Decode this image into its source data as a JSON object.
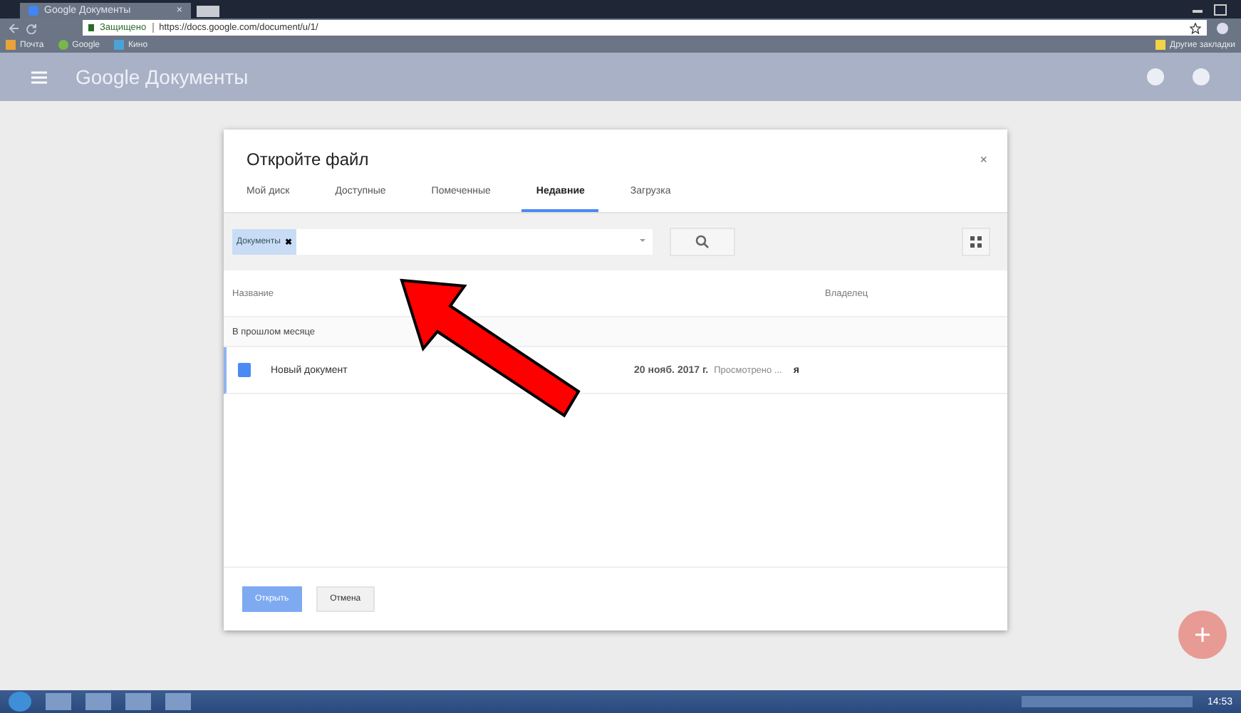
{
  "browser": {
    "tab_title": "Google Документы",
    "tab_close": "×",
    "secure_label": "Защищено",
    "url": "https://docs.google.com/document/u/1/",
    "bookmarks": [
      {
        "label": "Почта",
        "kind": "mail"
      },
      {
        "label": "Google",
        "kind": "google"
      },
      {
        "label": "Кино",
        "kind": "page"
      }
    ],
    "other_bookmarks": "Другие закладки"
  },
  "app": {
    "title": "Google Документы"
  },
  "dialog": {
    "title": "Откройте файл",
    "close": "×",
    "tabs": [
      {
        "label": "Мой диск",
        "selected": false
      },
      {
        "label": "Доступные",
        "selected": false
      },
      {
        "label": "Помеченные",
        "selected": false
      },
      {
        "label": "Недавние",
        "selected": true
      },
      {
        "label": "Загрузка",
        "selected": false
      }
    ],
    "filter_chip": "Документы",
    "chip_remove": "✖",
    "columns": [
      "Название",
      "Владелец"
    ],
    "group": "В прошлом месяце",
    "rows": [
      {
        "name": "Новый документ",
        "date": "20 нояб. 2017 г.",
        "action": "Просмотрено ...",
        "owner": "я",
        "selected": true
      }
    ],
    "buttons": [
      {
        "label": "Открыть",
        "kind": "primary",
        "disabled": true
      },
      {
        "label": "Отмена",
        "kind": "secondary",
        "disabled": false
      }
    ]
  },
  "taskbar": {
    "time": "14:53"
  }
}
